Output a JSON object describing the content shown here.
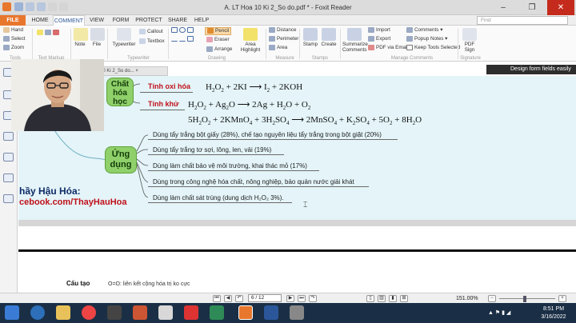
{
  "window": {
    "title": "A. LT Hoa 10 Ki 2_So do.pdf * - Foxit Reader",
    "controls": [
      "–",
      "❐",
      "✕"
    ]
  },
  "tabs": [
    "FILE",
    "HOME",
    "COMMENT",
    "VIEW",
    "FORM",
    "PROTECT",
    "SHARE",
    "HELP"
  ],
  "search": {
    "placeholder": "Find"
  },
  "ribbon": {
    "tools": [
      "Hand",
      "Select",
      "Zoom"
    ],
    "tools_group": "Tools",
    "text_markup_group": "Text Markup",
    "note": "Note",
    "file": "File",
    "typewriter": "Typewriter",
    "callout": "Callout",
    "textbox": "Textbox",
    "typewriter_group": "Typewriter",
    "pencil": "Pencil",
    "eraser": "Eraser",
    "arrange": "Arrange",
    "area_highlight": [
      "Area",
      "Highlight"
    ],
    "drawing_group": "Drawing",
    "distance": "Distance",
    "perimeter": "Perimeter",
    "area": "Area",
    "measure_group": "Measure",
    "stamp": "Stamp",
    "create": "Create",
    "stamps_group": "Stamps",
    "summarize": [
      "Summarize",
      "Comments"
    ],
    "import": "Import",
    "export": "Export",
    "pdf_via_email": "PDF via Email",
    "comments": "Comments",
    "popup_notes": "Popup Notes",
    "keep_tools": "Keep Tools Selected",
    "manage_group": "Manage Comments",
    "pdf_sign": [
      "PDF",
      "Sign"
    ],
    "signature_group": "Signature"
  },
  "document": {
    "tab_label": "10 Ki 2_So do...",
    "design_bar": "Design form fields easily",
    "node_chem": [
      "Chất",
      "hóa",
      "học"
    ],
    "oxidizing_label": "Tính oxi hóa",
    "reducing_label": "Tính khử",
    "node_app": [
      "Ứng",
      "dụng"
    ],
    "applications": [
      "Dùng tẩy trắng bột giấy (28%), chế tạo nguyên liệu tẩy trắng trong bột giặt (20%)",
      "Dùng tẩy trắng tơ sợi, lông, len, vải (19%)",
      "Dùng làm chất bảo vệ môi trường, khai thác mỏ (17%)",
      "Dùng trong công nghệ hóa chất, nông nghiệp, bảo quản nước giải khát",
      "Dùng làm chất sát trùng (dung dịch H₂O₂ 3%)."
    ],
    "teacher_name": "hầy Hậu Hóa:",
    "teacher_fb": "cebook.com/ThayHauHoa",
    "page2_heading": "Cấu tạo",
    "page2_text": "O=O: liên kết cộng hóa trị ko cực"
  },
  "status": {
    "page": "6 / 12",
    "zoom": "151.00%"
  },
  "taskbar": {
    "time": "8:51 PM",
    "date": "3/16/2022"
  }
}
